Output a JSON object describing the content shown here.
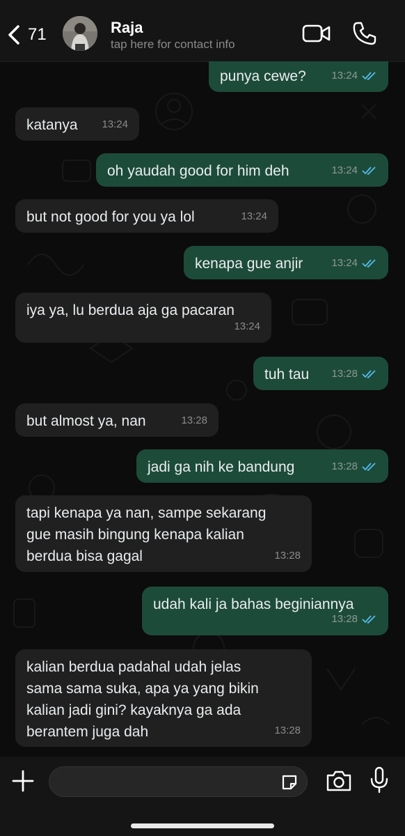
{
  "header": {
    "back_count": "71",
    "contact_name": "Raja",
    "contact_subtitle": "tap here for contact info"
  },
  "messages": [
    {
      "dir": "out",
      "text": "punya cewe?",
      "time": "13:24",
      "read": true
    },
    {
      "dir": "in",
      "text": "katanya",
      "time": "13:24"
    },
    {
      "dir": "out",
      "text": "oh yaudah good for him deh",
      "time": "13:24",
      "read": true
    },
    {
      "dir": "in",
      "text": "but not good for you ya lol",
      "time": "13:24"
    },
    {
      "dir": "out",
      "text": "kenapa gue anjir",
      "time": "13:24",
      "read": true
    },
    {
      "dir": "in",
      "text": "iya ya, lu berdua aja ga pacaran",
      "time": "13:24"
    },
    {
      "dir": "out",
      "text": "tuh tau",
      "time": "13:28",
      "read": true
    },
    {
      "dir": "in",
      "text": "but almost ya, nan",
      "time": "13:28"
    },
    {
      "dir": "out",
      "text": "jadi ga nih ke bandung",
      "time": "13:28",
      "read": true
    },
    {
      "dir": "in",
      "lines": [
        "tapi kenapa ya nan, sampe sekarang",
        "gue masih bingung kenapa kalian",
        "berdua bisa gagal"
      ],
      "time": "13:28"
    },
    {
      "dir": "out",
      "text": "udah kali ja bahas beginiannya",
      "time": "13:28",
      "read": true
    },
    {
      "dir": "in",
      "lines": [
        "kalian berdua padahal udah jelas",
        "sama sama suka, apa ya yang bikin",
        "kalian jadi gini? kayaknya ga ada",
        "berantem juga dah"
      ],
      "time": "13:28"
    }
  ],
  "composer": {
    "placeholder": ""
  },
  "colors": {
    "outgoing_bubble": "#1d4b39",
    "incoming_bubble": "#202020",
    "read_ticks": "#53bdeb",
    "background": "#0c0c0c"
  },
  "icons": [
    "back-chevron-icon",
    "video-call-icon",
    "phone-icon",
    "plus-icon",
    "sticker-icon",
    "camera-icon",
    "microphone-icon",
    "double-check-icon"
  ]
}
